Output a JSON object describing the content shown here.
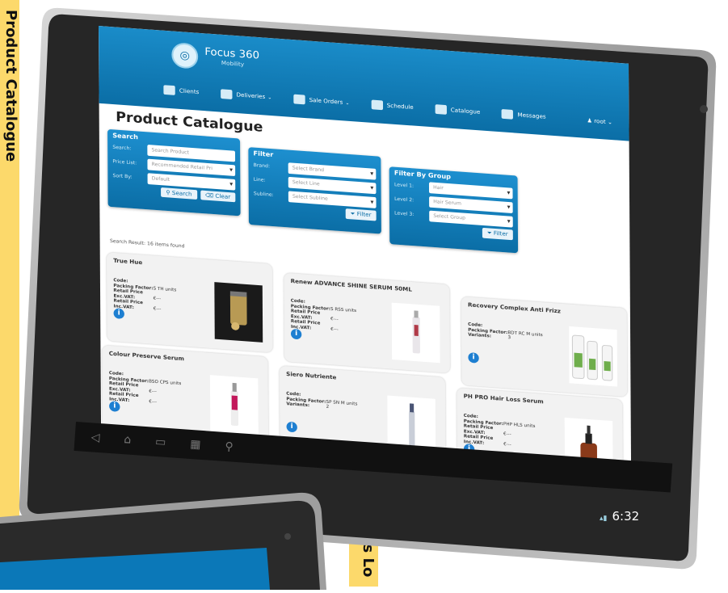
{
  "side_tabs": {
    "left": "Product Catalogue",
    "right": "Sales Lo"
  },
  "app": {
    "logo_name": "Focus 360",
    "logo_sub": "Mobility"
  },
  "nav": [
    {
      "label": "Clients",
      "has_menu": false
    },
    {
      "label": "Deliveries",
      "has_menu": true
    },
    {
      "label": "Sale Orders",
      "has_menu": true
    },
    {
      "label": "Schedule",
      "has_menu": false
    },
    {
      "label": "Catalogue",
      "has_menu": false
    },
    {
      "label": "Messages",
      "has_menu": false
    }
  ],
  "user": {
    "label": "root"
  },
  "page_title": "Product Catalogue",
  "search": {
    "title": "Search",
    "search_label": "Search:",
    "search_placeholder": "Search Product",
    "price_label": "Price List:",
    "price_value": "Recommended Retail Pri",
    "sort_label": "Sort By:",
    "sort_value": "Default",
    "search_button": "Search",
    "clear_button": "Clear"
  },
  "filter": {
    "title": "Filter",
    "brand_label": "Brand:",
    "brand_value": "Select Brand",
    "line_label": "Line:",
    "line_value": "Select Line",
    "subline_label": "Subline:",
    "subline_value": "Select Subline",
    "filter_button": "Filter"
  },
  "group_filter": {
    "title": "Filter By Group",
    "level1_label": "Level 1:",
    "level1_value": "Hair",
    "level2_label": "Level 2:",
    "level2_value": "Hair Serum",
    "level3_label": "Level 3:",
    "level3_value": "Select Group",
    "filter_button": "Filter"
  },
  "result_text": "Search Result: 16 items found",
  "products": [
    {
      "title": "True Hue",
      "labels": [
        "Code:",
        "Packing Factor:",
        "Retail Price Exc.VAT:",
        "Retail Price Inc.VAT:"
      ],
      "values": [
        "",
        "S TH",
        "units",
        "€---",
        "€---"
      ]
    },
    {
      "title": "Renew ADVANCE SHINE SERUM 50ML",
      "labels": [
        "Code:",
        "Packing Factor:",
        "Retail Price Exc.VAT:",
        "Retail Price Inc.VAT:"
      ],
      "values": [
        "",
        "S RSS",
        "units",
        "€---",
        "€---"
      ]
    },
    {
      "title": "Recovery Complex Anti Frizz",
      "labels": [
        "Code:",
        "Packing Factor:",
        "Variants:"
      ],
      "values": [
        "",
        "BDT RC M",
        "units",
        "3"
      ]
    },
    {
      "title": "Colour Preserve Serum",
      "labels": [
        "Code:",
        "Packing Factor:",
        "Retail Price Exc.VAT:",
        "Retail Price Inc.VAT:"
      ],
      "values": [
        "",
        "BSO CPS",
        "units",
        "€---",
        "€---"
      ]
    },
    {
      "title": "Siero Nutriente",
      "labels": [
        "Code:",
        "Packing Factor:",
        "Variants:"
      ],
      "values": [
        "",
        "SP SN M",
        "units",
        "2"
      ]
    },
    {
      "title": "PH PRO Hair Loss Serum",
      "labels": [
        "Code:",
        "Packing Factor:",
        "Retail Price Exc.VAT:",
        "Retail Price Inc.VAT:"
      ],
      "values": [
        "",
        "PHP HLS",
        "units",
        "€---",
        "€---"
      ]
    }
  ],
  "status": {
    "time": "6:32"
  },
  "colors": {
    "brand_blue": "#0b6ea6",
    "tab_yellow": "#fcd96b",
    "bezel": "#2b2b2b"
  }
}
